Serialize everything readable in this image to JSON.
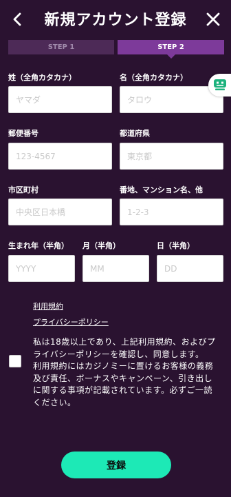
{
  "header": {
    "title": "新規アカウント登録",
    "back_icon": "chevron-left-icon",
    "close_icon": "close-icon"
  },
  "steps": [
    {
      "label": "STEP 1",
      "state": "inactive"
    },
    {
      "label": "STEP 2",
      "state": "active"
    }
  ],
  "form": {
    "last_name": {
      "label": "姓（全角カタカナ）",
      "placeholder": "ヤマダ",
      "value": ""
    },
    "first_name": {
      "label": "名（全角カタカナ）",
      "placeholder": "タロウ",
      "value": ""
    },
    "postal_code": {
      "label": "郵便番号",
      "placeholder": "123-4567",
      "value": ""
    },
    "prefecture": {
      "label": "都道府県",
      "placeholder": "東京都",
      "value": ""
    },
    "city": {
      "label": "市区町村",
      "placeholder": "中央区日本橋",
      "value": ""
    },
    "address": {
      "label": "番地、マンション名、他",
      "placeholder": "1-2-3",
      "value": ""
    },
    "birth_year": {
      "label": "生まれ年（半角）",
      "placeholder": "YYYY",
      "value": ""
    },
    "birth_month": {
      "label": "月（半角）",
      "placeholder": "MM",
      "value": ""
    },
    "birth_day": {
      "label": "日（半角）",
      "placeholder": "DD",
      "value": ""
    }
  },
  "links": {
    "terms": "利用規約",
    "privacy": "プライバシーポリシー"
  },
  "agreement": {
    "checked": false,
    "text1": "私は18歳以上であり、上記利用規約、およびプライバシーポリシーを確認し、同意します。",
    "text2": "利用規約にはカジノミーに置けるお客様の義務及び責任、ボーナスやキャンペーン、引き出しに関する事項が記載されています。必ずご一読ください。"
  },
  "submit_label": "登録",
  "chat_icon": "chatbot-icon",
  "colors": {
    "background": "#2a1230",
    "step_active": "#7d3a9a",
    "step_inactive": "#4d2a57",
    "accent": "#1de9b6"
  }
}
